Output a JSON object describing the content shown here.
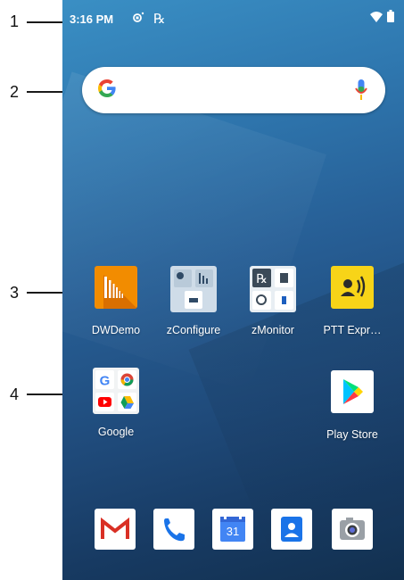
{
  "callouts": [
    "1",
    "2",
    "3",
    "4"
  ],
  "status_bar": {
    "time": "3:16 PM",
    "icons": [
      "nfc-icon",
      "rx-icon",
      "wifi-icon",
      "battery-icon"
    ],
    "rx_glyph": "℞"
  },
  "search": {
    "logo": "G",
    "mic_icon": "mic-icon"
  },
  "apps": [
    {
      "label": "DWDemo",
      "icon": "dwdemo-icon"
    },
    {
      "label": "zConfigure",
      "icon": "zconfigure-icon"
    },
    {
      "label": "zMonitor",
      "icon": "zmonitor-icon"
    },
    {
      "label": "PTT Expr…",
      "icon": "ptt-express-icon"
    },
    {
      "label": "Google",
      "icon": "google-folder-icon"
    },
    {
      "label": "Play Store",
      "icon": "play-store-icon"
    }
  ],
  "dock": [
    "gmail-icon",
    "phone-icon",
    "calendar-icon",
    "contacts-icon",
    "camera-icon"
  ],
  "calendar_day": "31",
  "colors": {
    "dwdemo": "#f28c00",
    "ptt": "#f7d418",
    "google_blue": "#4285f4",
    "google_red": "#ea4335",
    "google_yellow": "#fbbc05",
    "google_green": "#34a853"
  }
}
